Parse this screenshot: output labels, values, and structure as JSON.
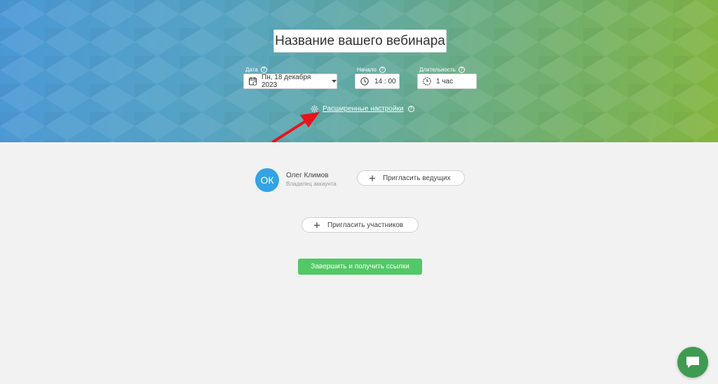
{
  "header": {
    "webinar_title": "Название вашего вебинара",
    "date_label": "Дата",
    "date_value": "Пн, 18 декабря 2023",
    "start_label": "Начало",
    "start_value": "14 : 00",
    "duration_label": "Длительность",
    "duration_value": "1 час",
    "help_glyph": "?",
    "advanced_settings": "Расширенные настройки"
  },
  "hosts": {
    "owner_initials": "ОК",
    "owner_name": "Олег Климов",
    "owner_role": "Владелец аккаунта",
    "invite_hosts": "Пригласить ведущих"
  },
  "participants": {
    "invite_participants": "Пригласить участников"
  },
  "actions": {
    "finish": "Завершить и получить ссылки"
  },
  "icons": {
    "plus": "+"
  },
  "colors": {
    "avatar": "#33a3e3",
    "primary_button": "#52c866",
    "chat_button": "#3f9b52",
    "annotation_arrow": "#e8131b"
  }
}
